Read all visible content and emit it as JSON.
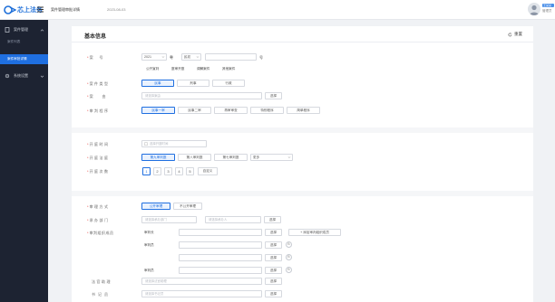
{
  "topbar": {
    "logo_text": "芯上法务",
    "toggle_icon": "menu-fold-icon",
    "breadcrumb": "案件管理审批详情",
    "date": "2023-08-03",
    "user_name": "王某某",
    "user_role": "管理员"
  },
  "sidebar": {
    "items": [
      {
        "label": "案件管理",
        "icon": "file-icon",
        "expanded": true
      },
      {
        "label": "系统设置",
        "icon": "gear-icon",
        "expanded": false
      }
    ],
    "sub_items": [
      {
        "label": "案件列表",
        "active": false
      },
      {
        "label": "案件审批详情",
        "active": true
      }
    ]
  },
  "card": {
    "title": "基本信息",
    "reset_label": "重置",
    "reset_icon": "refresh-icon"
  },
  "form": {
    "case_no": {
      "label": "案　号",
      "year": "2021",
      "court_prefix": "粤",
      "court": "民初",
      "number": "",
      "suffix": "号"
    },
    "case_type_tags": [
      "公开宣判",
      "庭审开庭",
      "调解案件",
      "其他案件"
    ],
    "case_nature": {
      "label": "案件类型",
      "options": [
        "民事",
        "刑事",
        "行政"
      ],
      "selected": 0
    },
    "cause": {
      "label": "案　由",
      "placeholder": "请选择案由",
      "button": "选择"
    },
    "procedure": {
      "label": "审判程序",
      "options": [
        "民事一审",
        "民事二审",
        "再审审查",
        "特别程序",
        "简单程序"
      ],
      "selected": 0
    },
    "hearing_time": {
      "label": "开庭时间",
      "placeholder": "选择开庭时间",
      "icon": "calendar-icon"
    },
    "court_room": {
      "label": "开庭法庭",
      "options": [
        "第九审判庭",
        "第八审判庭",
        "第七审判庭"
      ],
      "selected": 0,
      "more": "更多"
    },
    "sessions": {
      "label": "开庭次数",
      "pages": [
        "1",
        "2",
        "3",
        "4",
        "5"
      ],
      "selected": 0,
      "custom": "自定义"
    },
    "review_mode": {
      "label": "审理方式",
      "options": [
        "公开审理",
        "不公开审理"
      ],
      "selected": 0
    },
    "handling_dept": {
      "label": "承办部门",
      "dept_placeholder": "请选择承办部门",
      "person_placeholder": "请选择承办人",
      "button": "选择"
    },
    "panel": {
      "label": "审判组织成员",
      "rows": [
        {
          "role": "审判长",
          "button": "选择",
          "extra": "+ 添加审判组织成员"
        },
        {
          "role": "审判员",
          "button": "选择",
          "circle": "B"
        },
        {
          "role": "",
          "button": "选择",
          "circle": "B"
        },
        {
          "role": "审判员",
          "button": "选择",
          "circle": "B"
        }
      ]
    },
    "assistant": {
      "label": "法官助理",
      "placeholder": "请选择法官助理",
      "button": "选择"
    },
    "clerk": {
      "label": "书记员",
      "placeholder": "请选择书记员",
      "button": "选择"
    }
  }
}
